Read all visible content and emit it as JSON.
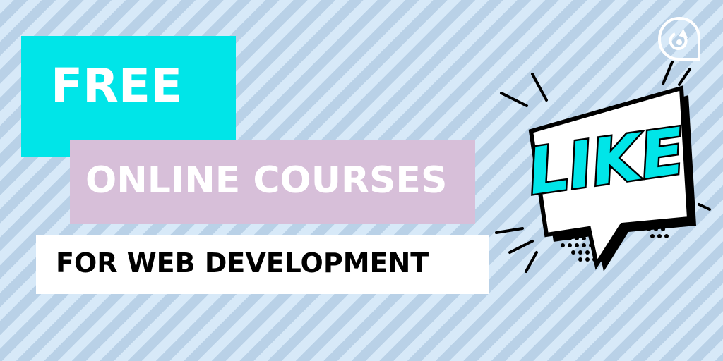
{
  "headline": {
    "free": "FREE",
    "courses": "ONLINE COURSES",
    "audience": "FOR WEB DEVELOPMENT"
  },
  "sticker": {
    "text": "LIKE",
    "icon": "speech-bubble-icon"
  },
  "logo": {
    "icon": "circular-arrow-logo-icon"
  },
  "colors": {
    "stripe_light": "#d7e9f8",
    "stripe_dark": "#b9d1e7",
    "cyan": "#00e5e8",
    "lavender": "#d7bfd9",
    "white": "#ffffff",
    "black": "#000000"
  }
}
